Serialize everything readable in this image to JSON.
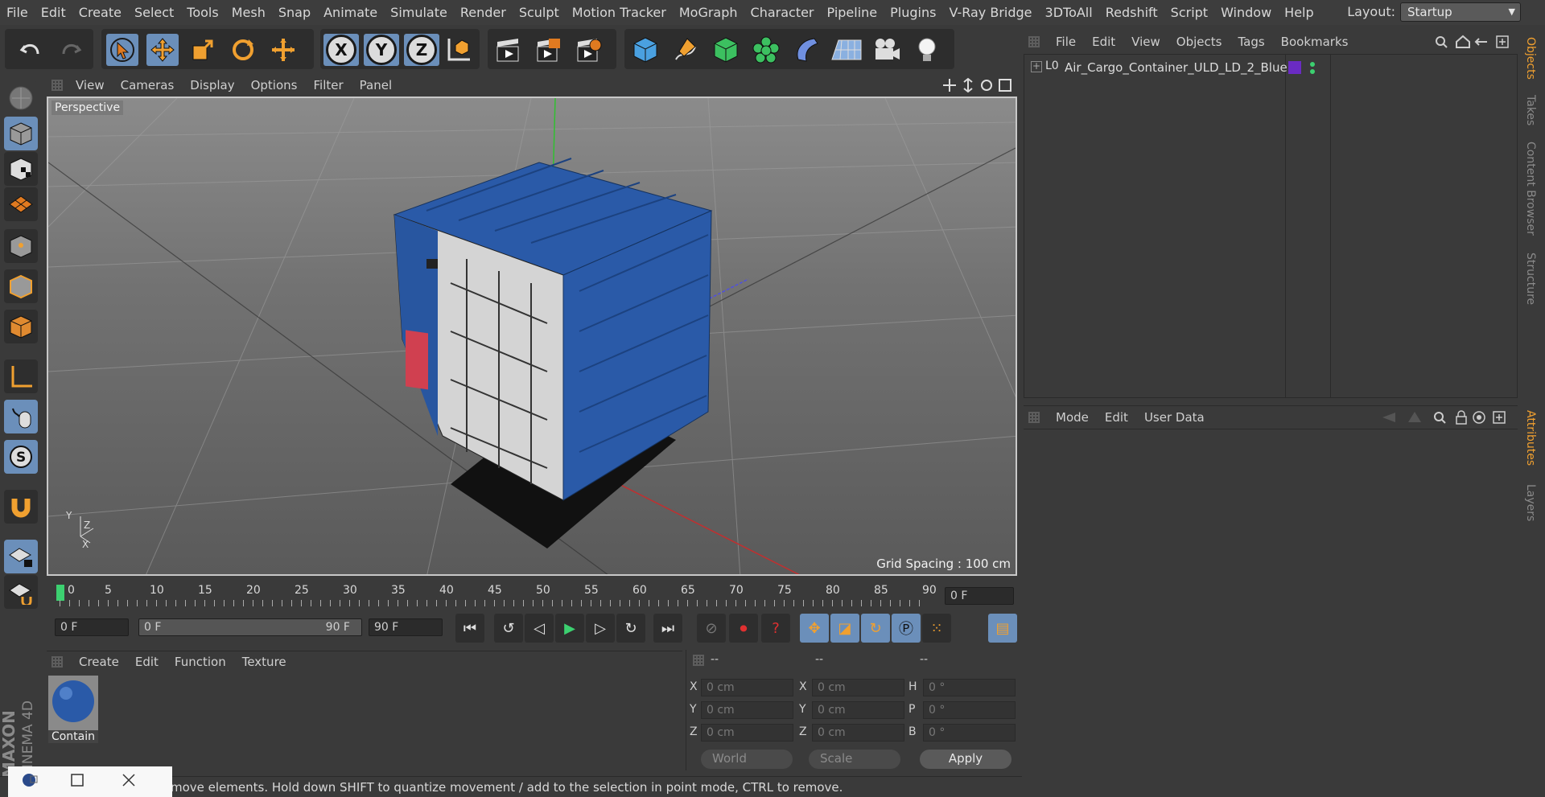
{
  "menubar": {
    "items": [
      "File",
      "Edit",
      "Create",
      "Select",
      "Tools",
      "Mesh",
      "Snap",
      "Animate",
      "Simulate",
      "Render",
      "Sculpt",
      "Motion Tracker",
      "MoGraph",
      "Character",
      "Pipeline",
      "Plugins",
      "V-Ray Bridge",
      "3DToAll",
      "Redshift",
      "Script",
      "Window",
      "Help"
    ],
    "layout_label": "Layout:",
    "layout_value": "Startup"
  },
  "viewport": {
    "menu": [
      "View",
      "Cameras",
      "Display",
      "Options",
      "Filter",
      "Panel"
    ],
    "label": "Perspective",
    "grid_spacing": "Grid Spacing : 100 cm",
    "axes": {
      "y": "Y",
      "z": "Z",
      "x": "X"
    }
  },
  "timeline": {
    "ticks": [
      "0",
      "5",
      "10",
      "15",
      "20",
      "25",
      "30",
      "35",
      "40",
      "45",
      "50",
      "55",
      "60",
      "65",
      "70",
      "75",
      "80",
      "85",
      "90"
    ],
    "current_frame": "0 F",
    "start_frame": "0 F",
    "range_start": "0 F",
    "range_end": "90 F",
    "end_frame": "90 F"
  },
  "material_panel": {
    "menu": [
      "Create",
      "Edit",
      "Function",
      "Texture"
    ],
    "material_name": "Contain"
  },
  "coordinates": {
    "headers": [
      "--",
      "--",
      "--"
    ],
    "rows": [
      {
        "a": "X",
        "av": "0 cm",
        "b": "X",
        "bv": "0 cm",
        "c": "H",
        "cv": "0 °"
      },
      {
        "a": "Y",
        "av": "0 cm",
        "b": "Y",
        "bv": "0 cm",
        "c": "P",
        "cv": "0 °"
      },
      {
        "a": "Z",
        "av": "0 cm",
        "b": "Z",
        "bv": "0 cm",
        "c": "B",
        "cv": "0 °"
      }
    ],
    "mode_select": "World",
    "scale_select": "Scale",
    "apply": "Apply"
  },
  "status_text": "move elements. Hold down SHIFT to quantize movement / add to the selection in point mode, CTRL to remove.",
  "object_manager": {
    "menu": [
      "File",
      "Edit",
      "View",
      "Objects",
      "Tags",
      "Bookmarks"
    ],
    "objects": [
      {
        "name": "Air_Cargo_Container_ULD_LD_2_Blue",
        "tag_color": "#6a2bc2"
      }
    ]
  },
  "attributes": {
    "menu": [
      "Mode",
      "Edit",
      "User Data"
    ]
  },
  "right_tabs": [
    "Objects",
    "Takes",
    "Content Browser",
    "Structure",
    "Attributes",
    "Layers"
  ],
  "brand": {
    "line1": "MAXON",
    "line2": "CINEMA 4D"
  },
  "colors": {
    "accent_blue": "#6b8fba",
    "active_tab": "#f0a030",
    "container_blue": "#2a5aa8"
  }
}
